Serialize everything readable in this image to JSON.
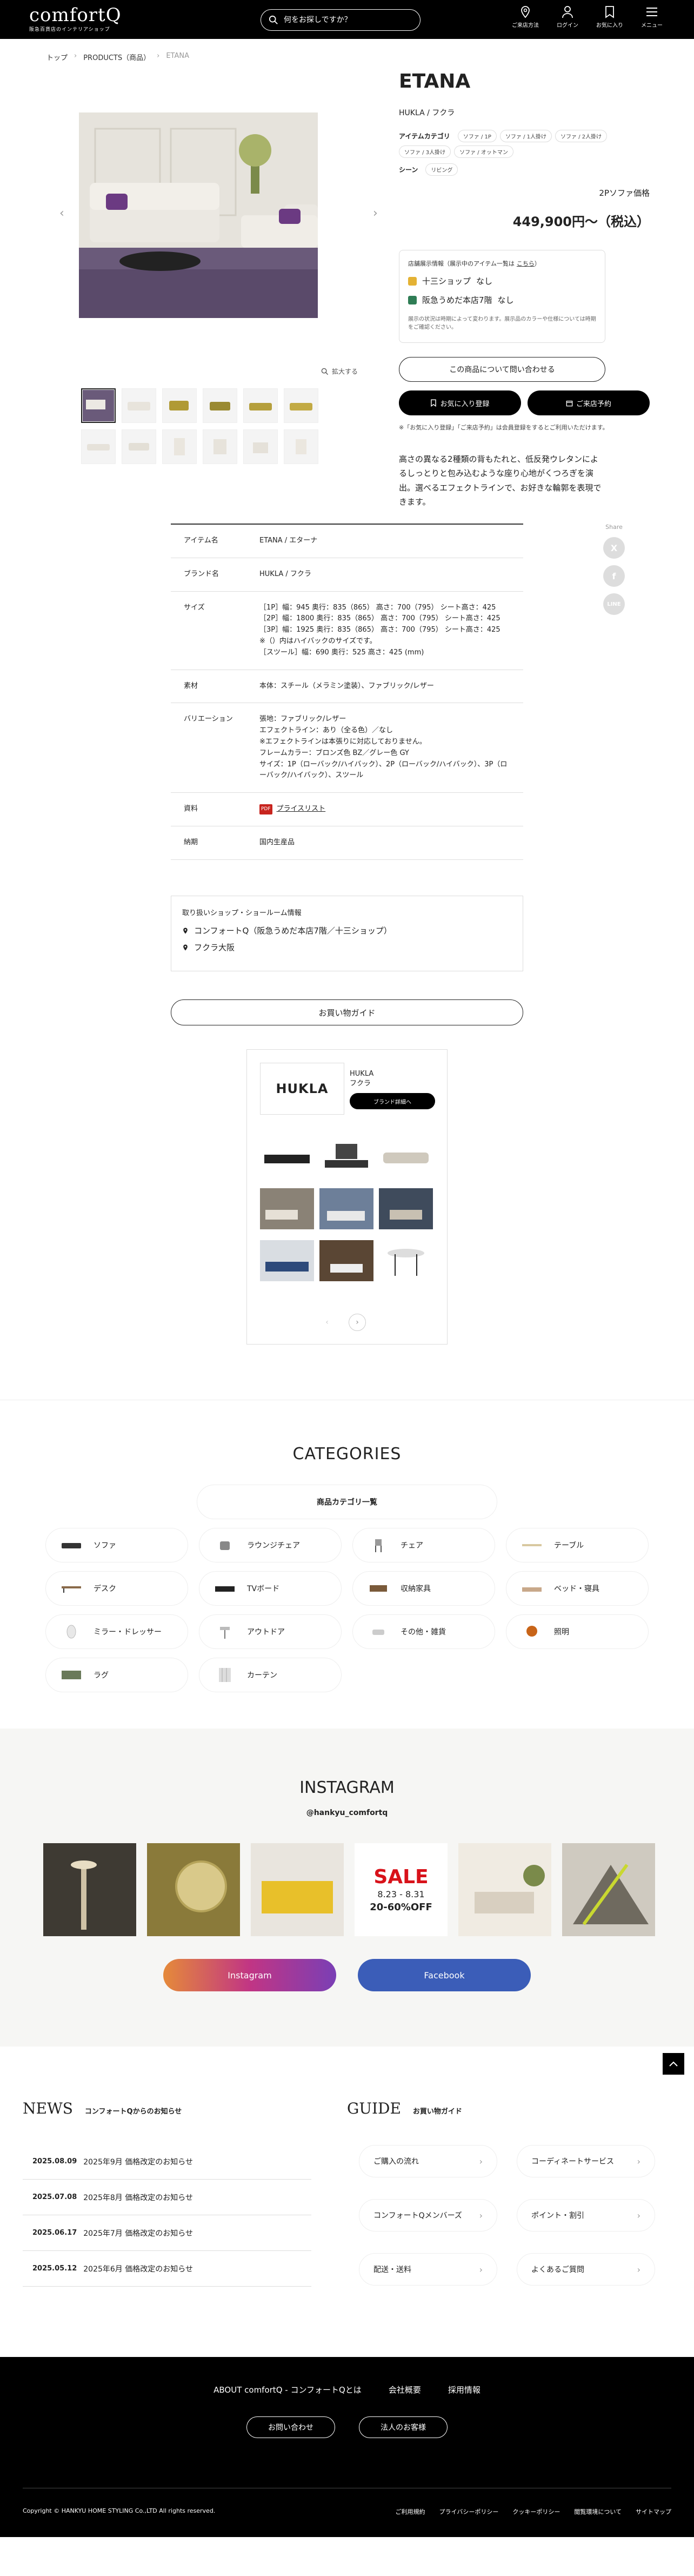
{
  "header": {
    "logo": "comfortQ",
    "logo_sub": "阪急百貨店のインテリアショップ",
    "search_placeholder": "何をお探しですか？",
    "nav": [
      {
        "label": "ご来店方法",
        "icon": "map-pin-icon"
      },
      {
        "label": "ログイン",
        "icon": "user-icon"
      },
      {
        "label": "お気に入り",
        "icon": "bookmark-icon"
      },
      {
        "label": "メニュー",
        "icon": "menu-icon"
      }
    ]
  },
  "breadcrumb": [
    "トップ",
    "PRODUCTS（商品）",
    "ETANA"
  ],
  "product": {
    "title": "ETANA",
    "brand": "HUKLA / フクラ",
    "category_label": "アイテムカテゴリ",
    "categories": [
      "ソファ / 1P",
      "ソファ / 1人掛け",
      "ソファ / 2人掛け",
      "ソファ / 3人掛け",
      "ソファ / オットマン"
    ],
    "scene_label": "シーン",
    "scenes": [
      "リビング"
    ],
    "zoom_label": "拡大する",
    "price_label": "2Pソファ価格",
    "price": "449,900円〜（税込）",
    "stock_title": "店舗展示情報（展示中のアイテム一覧は",
    "stock_link": "こちら",
    "stock_title_end": "）",
    "stock": [
      {
        "shop": "十三ショップ",
        "status": "なし",
        "color": "#e4b234"
      },
      {
        "shop": "阪急うめだ本店7階",
        "status": "なし",
        "color": "#2f7d55"
      }
    ],
    "stock_note": "展示の状況は時期によって変わります。展示品のカラーや仕様については時期をご確認ください。",
    "inquiry": "この商品について問い合わせる",
    "favorite": "お気に入り登録",
    "visit": "ご来店予約",
    "fav_note": "※「お気に入り登録」「ご来店予約」は会員登録をするとご利用いただけます。",
    "description": "高さの異なる2種類の背もたれと、低反発ウレタンによるしっとりと包み込むような座り心地がくつろぎを演出。選べるエフェクトラインで、お好きな輪郭を表現できます。"
  },
  "specs": [
    {
      "k": "アイテム名",
      "v": [
        "ETANA / エターナ"
      ]
    },
    {
      "k": "ブランド名",
      "v": [
        "HUKLA / フクラ"
      ]
    },
    {
      "k": "サイズ",
      "v": [
        "［1P］幅：945 奥行：835（865） 高さ：700（795） シート高さ：425",
        "［2P］幅：1800 奥行：835（865） 高さ：700（795） シート高さ：425",
        "［3P］幅：1925 奥行：835（865） 高さ：700（795） シート高さ：425",
        "※（）内はハイバックのサイズです。",
        "［スツール］幅：690 奥行：525 高さ：425 (mm)"
      ]
    },
    {
      "k": "素材",
      "v": [
        "本体：スチール（メラミン塗装）、ファブリック/レザー"
      ]
    },
    {
      "k": "バリエーション",
      "v": [
        "張地：ファブリック/レザー",
        "エフェクトライン：あり（全る色）／なし",
        "※エフェクトラインは本張りに対応しておりません。",
        "フレームカラー：ブロンズ色 BZ／グレー色 GY",
        "サイズ：1P（ローバック/ハイバック）、2P（ローバック/ハイバック）、3P（ローバック/ハイバック）、スツール"
      ]
    },
    {
      "k": "資料",
      "v": [
        "プライスリスト"
      ]
    },
    {
      "k": "納期",
      "v": [
        "国内生産品"
      ]
    }
  ],
  "share_label": "Share",
  "shop": {
    "title": "取り扱いショップ・ショールーム情報",
    "rows": [
      "コンフォートQ（阪急うめだ本店7階／十三ショップ）",
      "フクラ大阪"
    ]
  },
  "guide_button": "お買い物ガイド",
  "brand_card": {
    "logo": "HUKLA",
    "name_en": "HUKLA",
    "name_jp": "フクラ",
    "button": "ブランド詳細へ"
  },
  "categories": {
    "title": "CATEGORIES",
    "tab": "商品カテゴリ一覧",
    "items": [
      "ソファ",
      "ラウンジチェア",
      "チェア",
      "テーブル",
      "デスク",
      "TVボード",
      "収納家具",
      "ベッド・寝具",
      "ミラー・ドレッサー",
      "アウトドア",
      "その他・雑貨",
      "照明",
      "ラグ",
      "カーテン"
    ]
  },
  "instagram": {
    "title": "INSTAGRAM",
    "handle": "@hankyu_comfortq",
    "sale_text": "SALE",
    "sale_date": "8.23 - 8.31",
    "sale_off": "20-60%OFF",
    "btn_ig": "Instagram",
    "btn_fb": "Facebook"
  },
  "news": {
    "title": "NEWS",
    "subtitle": "コンフォートQからのお知らせ",
    "items": [
      {
        "date": "2025.08.09",
        "text": "2025年9月 価格改定のお知らせ"
      },
      {
        "date": "2025.07.08",
        "text": "2025年8月 価格改定のお知らせ"
      },
      {
        "date": "2025.06.17",
        "text": "2025年7月 価格改定のお知らせ"
      },
      {
        "date": "2025.05.12",
        "text": "2025年6月 価格改定のお知らせ"
      }
    ]
  },
  "guide": {
    "title": "GUIDE",
    "subtitle": "お買い物ガイド",
    "items": [
      "ご購入の流れ",
      "コーディネートサービス",
      "コンフォートQメンバーズ",
      "ポイント・割引",
      "配送・送料",
      "よくあるご質問"
    ]
  },
  "footer": {
    "links": [
      "ABOUT comfortQ - コンフォートQとは",
      "会社概要",
      "採用情報"
    ],
    "buttons": [
      "お問い合わせ",
      "法人のお客様"
    ],
    "copyright": "Copyright © HANKYU HOME STYLING Co.,LTD All rights reserved.",
    "sublinks": [
      "ご利用規約",
      "プライバシーポリシー",
      "クッキーポリシー",
      "閲覧環境について",
      "サイトマップ"
    ]
  }
}
